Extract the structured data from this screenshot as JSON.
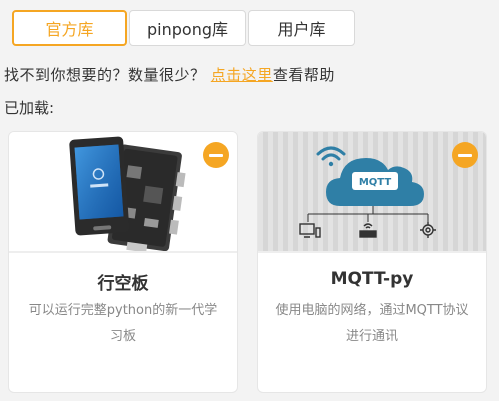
{
  "tabs": [
    {
      "label": "官方库",
      "active": true
    },
    {
      "label": "pinpong库",
      "active": false
    },
    {
      "label": "用户库",
      "active": false
    }
  ],
  "help": {
    "question": "找不到你想要的？数量很少？",
    "link": "点击这里",
    "suffix": "查看帮助"
  },
  "loaded_label": "已加载:",
  "cards": [
    {
      "title": "行空板",
      "desc": "可以运行完整python的新一代学习板",
      "icon": "board-photo"
    },
    {
      "title": "MQTT-py",
      "desc": "使用电脑的网络，通过MQTT协议进行通讯",
      "icon": "mqtt-cloud-icon",
      "cloud_label": "MQTT"
    }
  ],
  "colors": {
    "accent": "#f5a623",
    "cloud": "#2f7fa6"
  }
}
